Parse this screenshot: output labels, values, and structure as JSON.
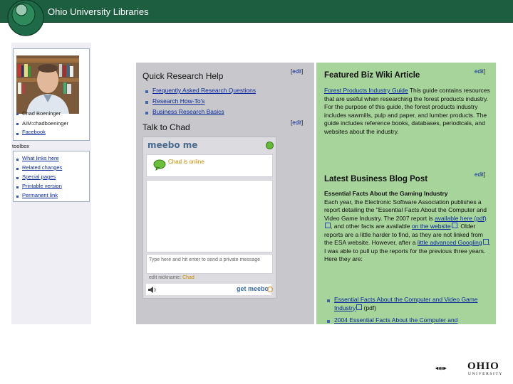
{
  "header": {
    "title": "Ohio University Libraries"
  },
  "sidebar": {
    "heading": "",
    "profile_links": [
      {
        "label": "Chad Boeninger"
      },
      {
        "label": "AIM:chadboeninger"
      },
      {
        "label": "Facebook"
      }
    ],
    "toolbox_title": "toolbox",
    "toolbox_links": [
      {
        "label": "What links here"
      },
      {
        "label": "Related changes"
      },
      {
        "label": "Special pages"
      },
      {
        "label": "Printable version"
      },
      {
        "label": "Permanent link"
      }
    ]
  },
  "quick_help": {
    "title": "Quick Research Help",
    "edit": "edit",
    "links": [
      "Frequently Asked Research Questions",
      "Research How-To's",
      "Business Research Basics"
    ]
  },
  "talk": {
    "title": "Talk to Chad",
    "edit": "edit",
    "meebo_title": "meebo me",
    "status": "Chad is online",
    "input_hint": "Type here and hit enter to send a private message",
    "nickname_label": "edit nickname:",
    "nickname_value": "Chad",
    "brand": "get meebo"
  },
  "featured": {
    "title": "Featured Biz Wiki Article",
    "edit": "edit",
    "link": "Forest Products Industry Guide",
    "text": " This guide contains resources that are useful when researching the forest products industry. For the purpose of this guide, the forest products industry includes sawmills, pulp and paper, and lumber products. The guide includes reference books, databases, periodicals, and websites about the industry."
  },
  "blog": {
    "title": "Latest Business Blog Post",
    "edit": "edit",
    "post_title": "Essential Facts About the Gaming Industry",
    "p1": "Each year, the Electronic Software Association publishes a report detailing the \"Essential Facts About the Computer and Video Game Industry. The 2007 report is ",
    "link1": "available here (pdf)",
    "p2": ", and other facts are available ",
    "link2": "on the website",
    "p3": ". Older reports are a little harder to find, as they are not linked from the ESA website. However, after a ",
    "link3": "little advanced Googling",
    "p4": ", I was able to pull up the reports for the previous three years. Here they are:",
    "items": [
      {
        "link": "Essential Facts About the Computer and Video Game Industry",
        "suffix": " (pdf)"
      },
      {
        "link": "2004 Essential Facts About the Computer and",
        "suffix": ""
      }
    ]
  },
  "footer": {
    "logo_text": "OHIO",
    "logo_sub": "UNIVERSITY"
  }
}
